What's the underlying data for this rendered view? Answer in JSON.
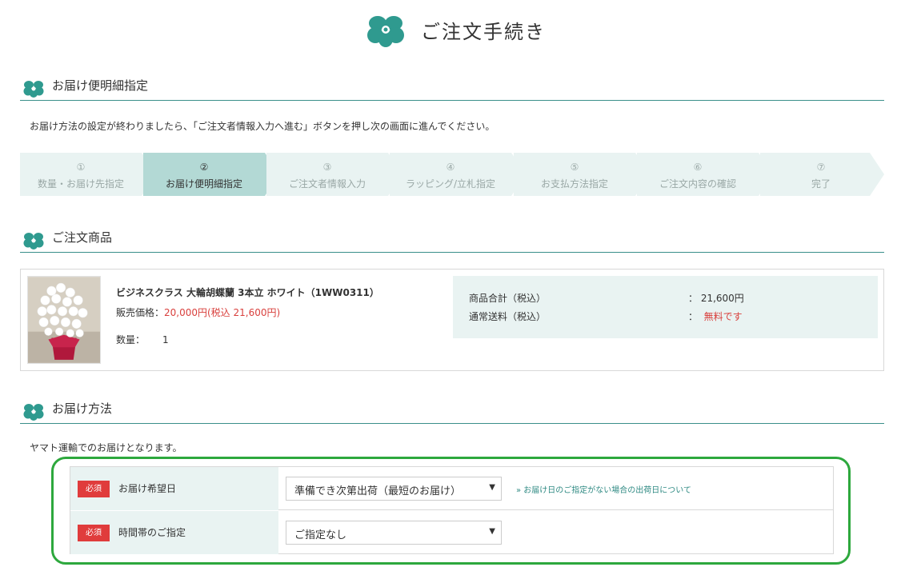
{
  "header": {
    "title": "ご注文手続き",
    "logo_icon": "orchid-logo-icon"
  },
  "section_delivery_detail": {
    "title": "お届け便明細指定",
    "notice": "お届け方法の設定が終わりましたら、「ご注文者情報入力へ進む」ボタンを押し次の画面に進んでください。"
  },
  "steps": [
    {
      "num": "①",
      "label": "数量・お届け先指定",
      "active": false
    },
    {
      "num": "②",
      "label": "お届け便明細指定",
      "active": true
    },
    {
      "num": "③",
      "label": "ご注文者情報入力",
      "active": false
    },
    {
      "num": "④",
      "label": "ラッピング/立札指定",
      "active": false
    },
    {
      "num": "⑤",
      "label": "お支払方法指定",
      "active": false
    },
    {
      "num": "⑥",
      "label": "ご注文内容の確認",
      "active": false
    },
    {
      "num": "⑦",
      "label": "完了",
      "active": false
    }
  ],
  "section_order": {
    "title": "ご注文商品",
    "product": {
      "name": "ビジネスクラス 大輪胡蝶蘭 3本立 ホワイト（1WW0311）",
      "price_label": "販売価格：",
      "price_value": "20,000円(税込 21,600円)",
      "qty_label": "数量：",
      "qty_value": "1"
    },
    "summary": {
      "subtotal_label": "商品合計（税込）",
      "subtotal_value": "：  21,600円",
      "shipping_label": "通常送料（税込）",
      "shipping_prefix": "：  ",
      "shipping_value": "無料です"
    }
  },
  "section_method": {
    "title": "お届け方法",
    "note": "ヤマト運輸でのお届けとなります。",
    "rows": [
      {
        "required": "必須",
        "label": "お届け希望日",
        "select_value": "準備でき次第出荷（最短のお届け）",
        "help": "» お届け日のご指定がない場合の出荷日について"
      },
      {
        "required": "必須",
        "label": "時間帯のご指定",
        "select_value": "ご指定なし"
      }
    ]
  },
  "colors": {
    "accent": "#3a8f8a",
    "step_bg": "#e9f3f2",
    "step_active": "#b3d9d5",
    "required_red": "#e03c3c",
    "price_red": "#d9403d",
    "highlight_green": "#2da83d"
  }
}
